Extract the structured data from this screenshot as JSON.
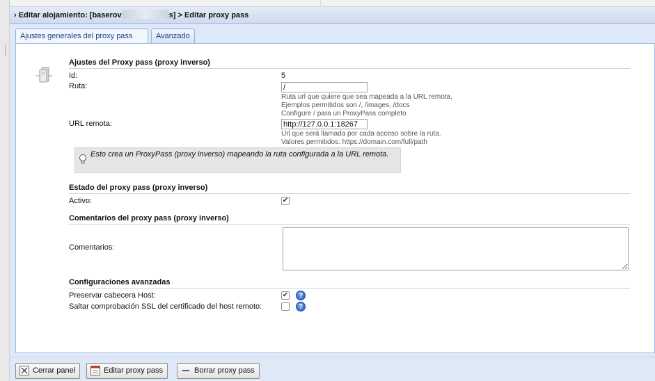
{
  "header": {
    "prefix": "› Editar alojamiento: [baserov",
    "suffix": "s] > Editar proxy pass"
  },
  "tabs": [
    {
      "label": "Ajustes generales del proxy pass",
      "active": true
    },
    {
      "label": "Avanzado",
      "active": false
    }
  ],
  "section_settings": {
    "title": "Ajustes del Proxy pass (proxy inverso)",
    "id_label": "Id:",
    "id_value": "5",
    "route_label": "Ruta:",
    "route_value": "/",
    "route_help": [
      "Ruta url que quiere que sea mapeada a la URL remota.",
      "Ejemplos permitidos son /, /images, /docs",
      "Configure / para un ProxyPass completo"
    ],
    "remote_label": "URL remota:",
    "remote_value": "http://127.0.0.1:18267",
    "remote_help": [
      "Url que será llamada por cada acceso sobre la ruta.",
      "Valores permitidos: https://domain.com/full/path"
    ],
    "tip": "Esto crea un ProxyPass (proxy inverso) mapeando la ruta configurada a la URL remota."
  },
  "section_state": {
    "title": "Estado del proxy pass (proxy inverso)",
    "active_label": "Activo:",
    "active_checked": true
  },
  "section_comments": {
    "title": "Comentarios del proxy pass (proxy inverso)",
    "comments_label": "Comentarios:",
    "comments_value": ""
  },
  "section_advanced": {
    "title": "Configuraciones avanzadas",
    "preserve_host_label": "Preservar cabecera Host:",
    "preserve_host_checked": true,
    "skip_ssl_label": "Saltar comprobación SSL del certificado del host remoto:",
    "skip_ssl_checked": false
  },
  "footer": {
    "close": "Cerrar panel",
    "edit": "Editar proxy pass",
    "delete": "Borrar proxy pass"
  },
  "icons": {
    "server": "server-icon",
    "bulb": "lightbulb-icon",
    "help": "question-icon",
    "close": "close-icon",
    "edit": "edit-icon",
    "delete": "delete-icon"
  }
}
